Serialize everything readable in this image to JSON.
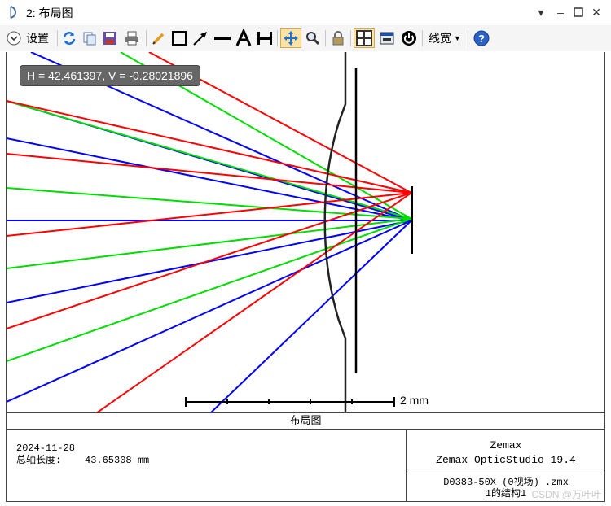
{
  "window": {
    "title": "2: 布局图"
  },
  "toolbar": {
    "settings_label": "设置",
    "linewidth_label": "线宽"
  },
  "readout": {
    "text": "H = 42.461397, V = -0.28021896"
  },
  "scale": {
    "label": "2 mm"
  },
  "titleblock": {
    "header": "布局图",
    "date": "2024-11-28",
    "axis_length": "总轴长度:    43.65308 mm",
    "company": "Zemax",
    "software": "Zemax OpticStudio 19.4",
    "file": "D0383-50X (0视场) .zmx",
    "config": "1的结构1"
  },
  "watermark": "CSDN @万叶叶",
  "colors": {
    "red": "#ff0000",
    "green": "#00dd00",
    "blue": "#0000ff",
    "accent": "#d6a94a"
  }
}
